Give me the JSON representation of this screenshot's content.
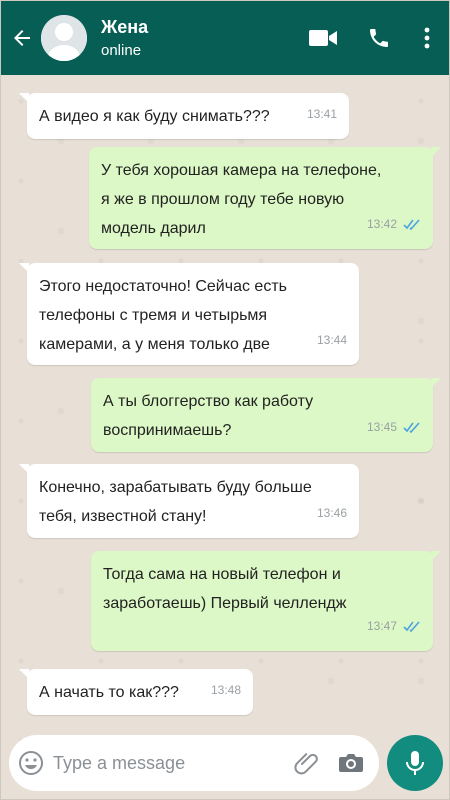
{
  "header": {
    "contact_name": "Жена",
    "status": "online"
  },
  "messages": [
    {
      "direction": "in",
      "text": "А видео я как буду снимать???",
      "time": "13:41"
    },
    {
      "direction": "out",
      "text": "У тебя хорошая камера на телефоне,\nя же в прошлом году тебе новую\nмодель дарил",
      "time": "13:42",
      "read": true
    },
    {
      "direction": "in",
      "text": "Этого недостаточно! Сейчас есть\nтелефоны с тремя и четырьмя\nкамерами, а у меня только две",
      "time": "13:44"
    },
    {
      "direction": "out",
      "text": "А ты блоггерство как работу\nвоспринимаешь?",
      "time": "13:45",
      "read": true
    },
    {
      "direction": "in",
      "text": "Конечно, зарабатывать буду больше\nтебя, известной стану!",
      "time": "13:46"
    },
    {
      "direction": "out",
      "text": "Тогда сама на новый телефон и\nзаработаешь) Первый челлендж",
      "time": "13:47",
      "read": true
    },
    {
      "direction": "in",
      "text": "А начать то как???",
      "time": "13:48"
    }
  ],
  "composer": {
    "placeholder": "Type a message"
  },
  "icons": {
    "back": "arrow-left-icon",
    "video": "video-camera-icon",
    "call": "phone-icon",
    "menu": "more-vertical-icon",
    "emoji": "emoji-icon",
    "attach": "paperclip-icon",
    "camera": "camera-icon",
    "mic": "microphone-icon"
  },
  "colors": {
    "header": "#075e54",
    "outgoing_bubble": "#dcf8c6",
    "incoming_bubble": "#ffffff",
    "read_ticks": "#4fa3e0",
    "mic_button": "#128c7e"
  }
}
